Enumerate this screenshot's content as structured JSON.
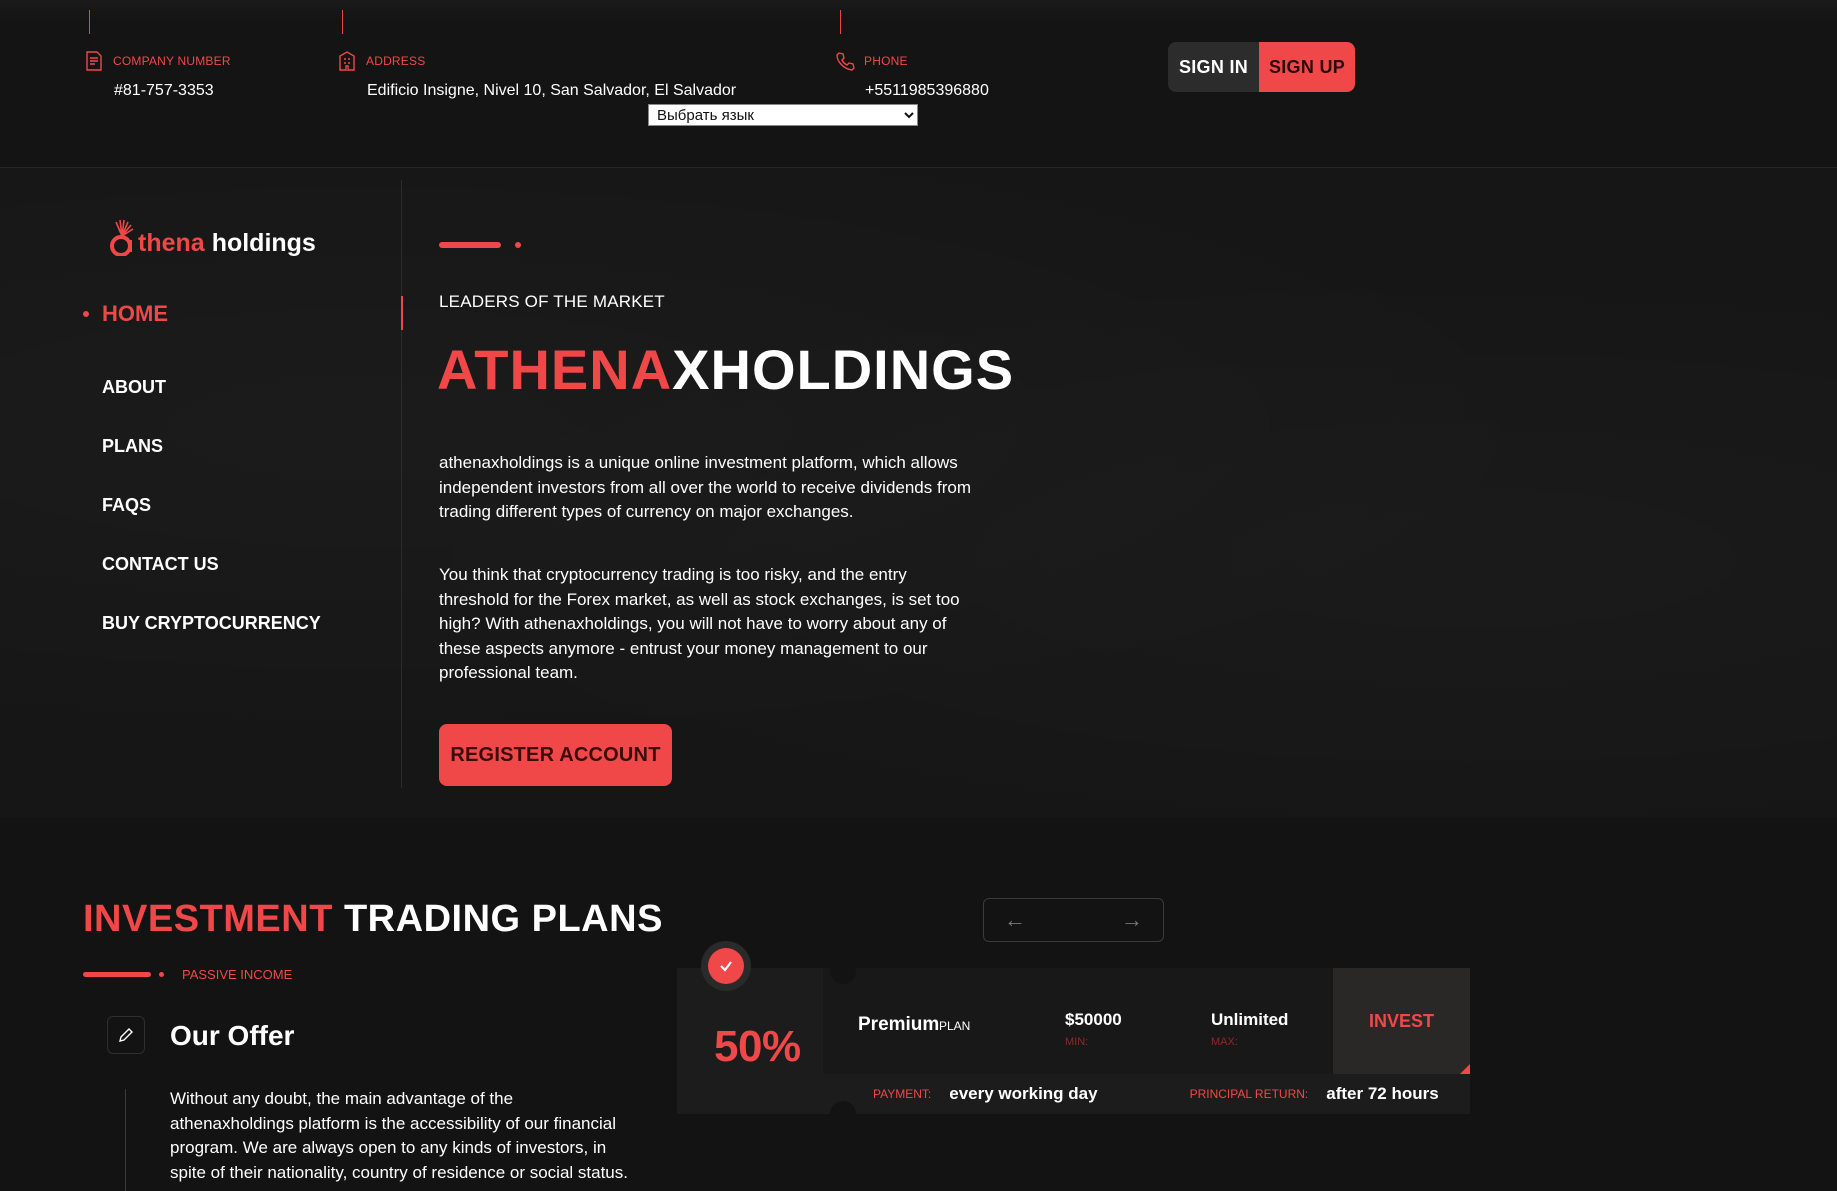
{
  "topbar": {
    "company_number": {
      "label": "COMPANY NUMBER",
      "value": "#81-757-3353",
      "icon": "document-icon"
    },
    "address": {
      "label": "ADDRESS",
      "value": "Edificio Insigne, Nivel 10, San Salvador, El Salvador",
      "icon": "building-icon"
    },
    "phone": {
      "label": "PHONE",
      "value": "+5511985396880",
      "icon": "phone-icon"
    },
    "language_select": "Выбрать язык",
    "sign_in": "SIGN IN",
    "sign_up": "SIGN UP"
  },
  "brand": {
    "part1": "thena",
    "part2": "holdings"
  },
  "nav": {
    "items": [
      {
        "label": "HOME"
      },
      {
        "label": "ABOUT"
      },
      {
        "label": "PLANS"
      },
      {
        "label": "FAQS"
      },
      {
        "label": "CONTACT US"
      },
      {
        "label": "BUY CRYPTOCURRENCY"
      }
    ]
  },
  "hero": {
    "kicker": "LEADERS OF THE MARKET",
    "headline_red": "ATHENA",
    "headline_white": "XHOLDINGS",
    "para1": "athenaxholdings is a unique online investment platform, which allows independent investors from all over the world to receive dividends from trading different types of currency on major exchanges.",
    "para2": "You think that cryptocurrency trading is too risky, and the entry threshold for the Forex market, as well as stock exchanges, is set too high? With athenaxholdings, you will not have to worry about any of these aspects anymore - entrust your money management to our professional team.",
    "register": "REGISTER ACCOUNT"
  },
  "plans": {
    "title_red": "INVESTMENT",
    "title_white": "TRADING PLANS",
    "tag": "PASSIVE INCOME",
    "arrow_prev": "←",
    "arrow_next": "→",
    "offer_title": "Our Offer",
    "offer_text": "Without any doubt, the main advantage of the athenaxholdings platform is the accessibility of our financial program. We are always open to any kinds of investors, in spite of their nationality, country of residence or social status.",
    "card": {
      "percent": "50%",
      "name": "Premium",
      "plan_label": "PLAN",
      "min_value": "$50000",
      "min_label": "MIN:",
      "max_value": "Unlimited",
      "max_label": "MAX:",
      "invest": "INVEST",
      "payment_label": "PAYMENT:",
      "payment_value": "every working day",
      "return_label": "PRINCIPAL RETURN:",
      "return_value": "after 72 hours"
    }
  },
  "colors": {
    "accent": "#f04848",
    "background": "#131313"
  }
}
